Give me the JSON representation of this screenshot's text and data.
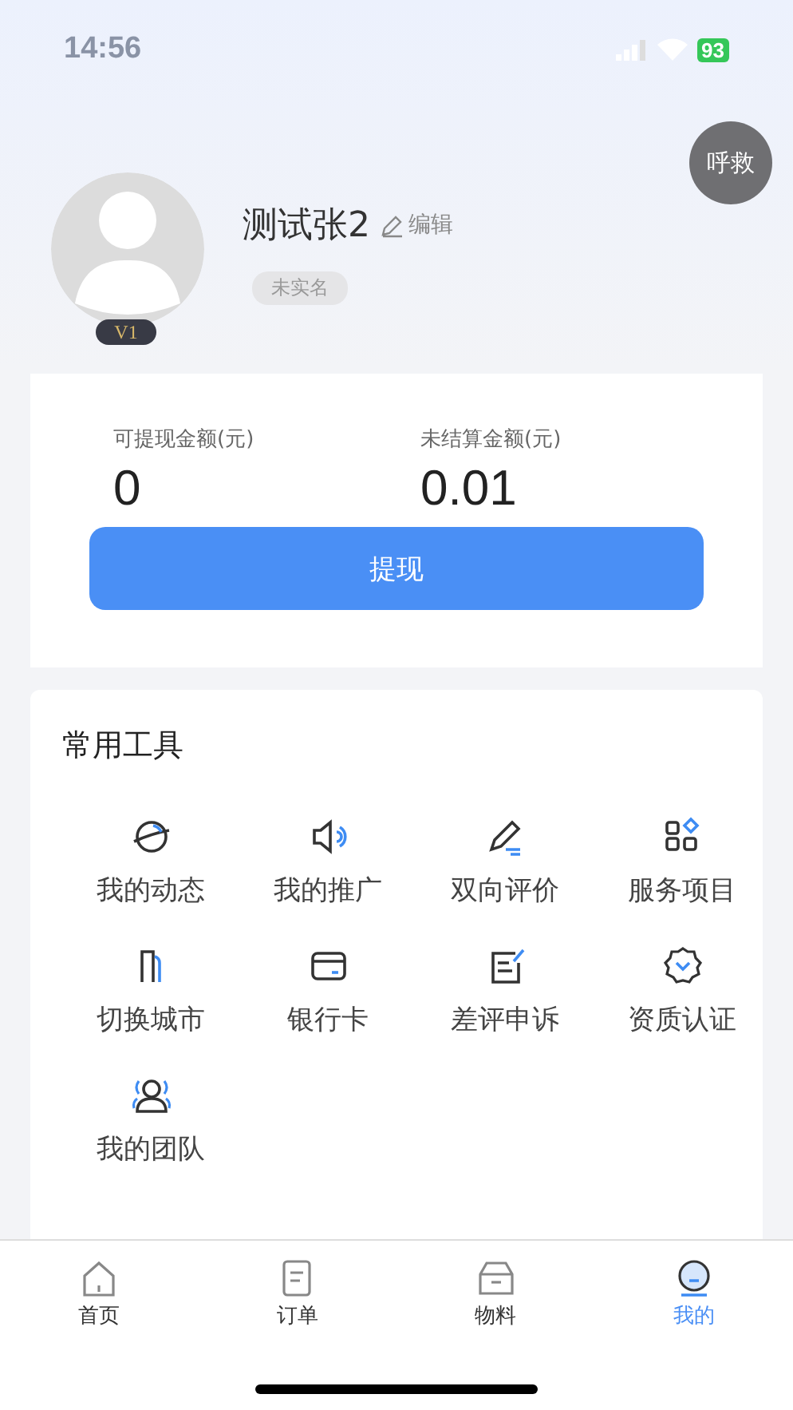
{
  "status_bar": {
    "time": "14:56",
    "battery": "93"
  },
  "sos_button": {
    "label": "呼救"
  },
  "profile": {
    "name": "测试张2",
    "edit_label": "编辑",
    "badge": "未实名",
    "level": "V1"
  },
  "balance": {
    "items": [
      {
        "label": "可提现金额(元)",
        "value": "0"
      },
      {
        "label": "未结算金额(元)",
        "value": "0.01"
      }
    ],
    "button": "提现"
  },
  "tools": {
    "title": "常用工具",
    "items": [
      {
        "label": "我的动态"
      },
      {
        "label": "我的推广"
      },
      {
        "label": "双向评价"
      },
      {
        "label": "服务项目"
      },
      {
        "label": "切换城市"
      },
      {
        "label": "银行卡"
      },
      {
        "label": "差评申诉"
      },
      {
        "label": "资质认证"
      },
      {
        "label": "我的团队"
      }
    ]
  },
  "tab_bar": [
    {
      "label": "首页",
      "selected": false
    },
    {
      "label": "订单",
      "selected": false
    },
    {
      "label": "物料",
      "selected": false
    },
    {
      "label": "我的",
      "selected": true
    }
  ]
}
